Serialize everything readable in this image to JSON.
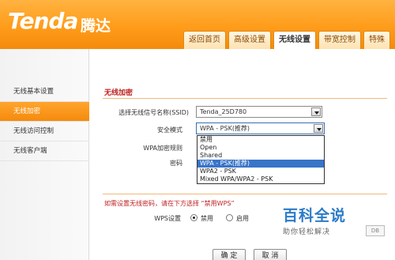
{
  "header": {
    "logo": "Tenda",
    "logo_cn": "腾达",
    "tabs": [
      "返回首页",
      "高级设置",
      "无线设置",
      "带宽控制",
      "特殊"
    ],
    "active_tab": "无线设置"
  },
  "sidebar": {
    "items": [
      {
        "label": "无线基本设置",
        "active": false
      },
      {
        "label": "无线加密",
        "active": true
      },
      {
        "label": "无线访问控制",
        "active": false
      },
      {
        "label": "无线客户端",
        "active": false
      }
    ]
  },
  "main": {
    "section_title": "无线加密",
    "ssid_label": "选择无线信号名称(SSID)",
    "ssid_value": "Tenda_25D780",
    "security_label": "安全模式",
    "security_value": "WPA - PSK(推荐)",
    "wpa_rule_label": "WPA加密规则",
    "password_label": "密码",
    "dropdown_options": [
      "禁用",
      "Open",
      "Shared",
      "WPA - PSK(推荐)",
      "WPA2 - PSK",
      "Mixed WPA/WPA2 - PSK"
    ],
    "dropdown_selected_index": 3,
    "wps_note": "如需设置无线密码，请在下方选择 “禁用WPS”",
    "wps_label": "WPS设置",
    "wps_options": [
      "禁用",
      "启用"
    ],
    "wps_selected": "禁用",
    "confirm_button": "确 定",
    "cancel_button": "取 消"
  },
  "watermark": {
    "title": "百科全说",
    "subtitle": "助你轻松解决",
    "badge": "DB"
  },
  "colors": {
    "header_orange": "#ff9c1a",
    "active_orange": "#f58a0c",
    "red_text": "#c02020",
    "selection_blue": "#3874c8"
  }
}
